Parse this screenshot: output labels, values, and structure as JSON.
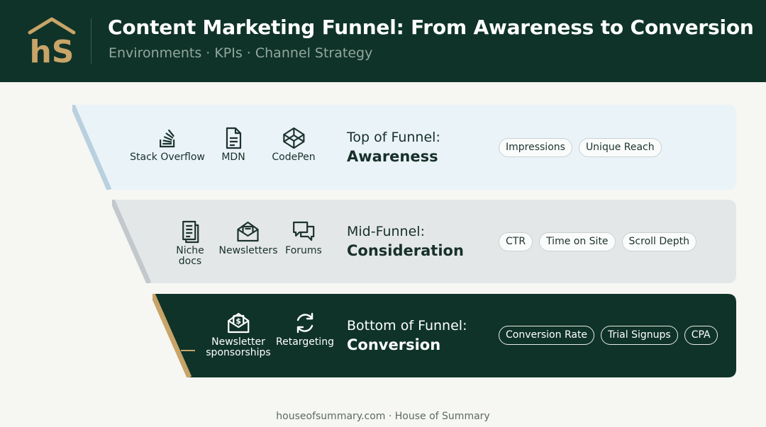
{
  "header": {
    "title": "Content Marketing Funnel: From Awareness to Conversion",
    "subtitle": "Environments · KPIs · Channel Strategy",
    "logo_text": "hS"
  },
  "colors": {
    "header_bg": "#0f3328",
    "gold": "#c8a468",
    "top_band": "#eaf3f8",
    "mid_band": "#e4e7e8",
    "bottom_band": "#0f3328"
  },
  "funnel": {
    "top": {
      "stage_line1": "Top of Funnel:",
      "stage_line2": "Awareness",
      "channels": [
        {
          "label": "Stack Overflow",
          "icon": "stack-overflow-icon"
        },
        {
          "label": "MDN",
          "icon": "document-icon"
        },
        {
          "label": "CodePen",
          "icon": "codepen-icon"
        }
      ],
      "kpis": [
        "Impressions",
        "Unique Reach"
      ]
    },
    "mid": {
      "stage_line1": "Mid-Funnel:",
      "stage_line2": "Consideration",
      "channels": [
        {
          "label_line1": "Niche",
          "label_line2": "docs",
          "icon": "docs-icon"
        },
        {
          "label": "Newsletters",
          "icon": "envelope-icon"
        },
        {
          "label": "Forums",
          "icon": "chat-bubbles-icon"
        }
      ],
      "kpis": [
        "CTR",
        "Time on Site",
        "Scroll Depth"
      ]
    },
    "bottom": {
      "stage_line1": "Bottom of Funnel:",
      "stage_line2": "Conversion",
      "channels": [
        {
          "label_line1": "Newsletter",
          "label_line2": "sponsorships",
          "icon": "dollar-envelope-icon"
        },
        {
          "label": "Retargeting",
          "icon": "refresh-icon"
        }
      ],
      "kpis": [
        "Conversion Rate",
        "Trial Signups",
        "CPA"
      ]
    }
  },
  "footer": {
    "text": "houseofsummary.com · House of Summary"
  }
}
